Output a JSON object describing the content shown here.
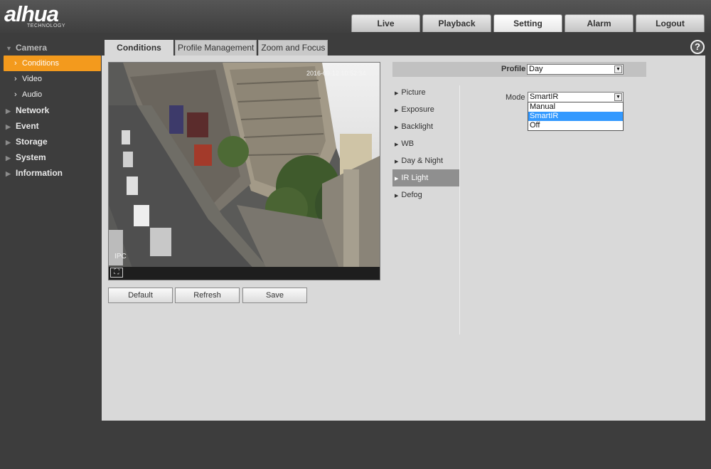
{
  "brand": {
    "logo": "alhua",
    "tagline": "TECHNOLOGY"
  },
  "topnav": [
    "Live",
    "Playback",
    "Setting",
    "Alarm",
    "Logout"
  ],
  "topnav_active": "Setting",
  "sidebar": {
    "camera": "Camera",
    "camera_items": [
      "Conditions",
      "Video",
      "Audio"
    ],
    "active_item": "Conditions",
    "categories": [
      "Network",
      "Event",
      "Storage",
      "System",
      "Information"
    ]
  },
  "subtabs": [
    "Conditions",
    "Profile Management",
    "Zoom and Focus"
  ],
  "help_label": "?",
  "video": {
    "overlay_label": "IPC",
    "timestamp": "2016-09-12 10:52:34"
  },
  "buttons": {
    "default": "Default",
    "refresh": "Refresh",
    "save": "Save"
  },
  "profile": {
    "label": "Profile",
    "value": "Day"
  },
  "menu": [
    "Picture",
    "Exposure",
    "Backlight",
    "WB",
    "Day & Night",
    "IR Light",
    "Defog"
  ],
  "menu_active": "IR Light",
  "mode": {
    "label": "Mode",
    "value": "SmartIR",
    "options": [
      "Manual",
      "SmartIR",
      "Off"
    ],
    "highlighted": "SmartIR"
  },
  "colors": {
    "accent": "#f39a1d",
    "selection": "#3399ff",
    "menu_active": "#8f8f8f"
  }
}
